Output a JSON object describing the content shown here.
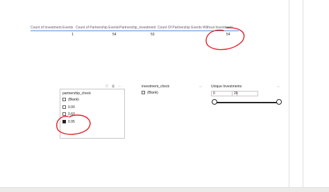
{
  "table": {
    "headers": [
      "Count of Investment Events",
      "Count of Partnership Events",
      "Partnership_investment",
      "Count Of Partnership Events Without Investment"
    ],
    "values": [
      "1",
      "54",
      "53",
      "54"
    ]
  },
  "partnership_slicer": {
    "title": "partnership_check",
    "items": [
      {
        "label": "(Blank)",
        "checked": false
      },
      {
        "label": "0.00",
        "checked": false
      },
      {
        "label": "0.60",
        "checked": false
      },
      {
        "label": "0.95",
        "checked": true
      }
    ],
    "header_icons": [
      "filter-icon",
      "focus-mode-icon",
      "more-options-icon"
    ]
  },
  "investment_slicer": {
    "title": "investment_check",
    "items": [
      {
        "label": "(Blank)",
        "checked": false
      }
    ]
  },
  "range_slicer": {
    "title": "Unique Investments",
    "min_value": "0",
    "max_value": "20",
    "selected_min_fraction": 0,
    "selected_max_fraction": 1
  },
  "colors": {
    "accent_line": "#5b8fd1",
    "annotation_ink": "#e0202a"
  }
}
